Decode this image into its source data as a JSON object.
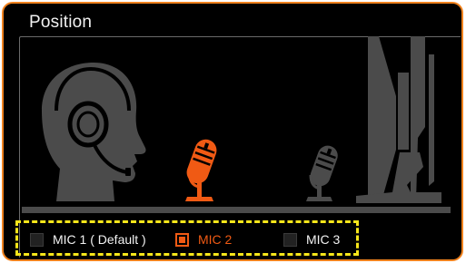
{
  "panel": {
    "title": "Position"
  },
  "mic_options": [
    {
      "label": "MIC 1 ( Default )",
      "selected": false
    },
    {
      "label": "MIC 2",
      "selected": true
    },
    {
      "label": "MIC 3",
      "selected": false
    }
  ],
  "colors": {
    "accent": "#f05a14",
    "border": "#f0821e",
    "highlight": "#f7e61a",
    "silhouette": "#4b4b4b"
  }
}
